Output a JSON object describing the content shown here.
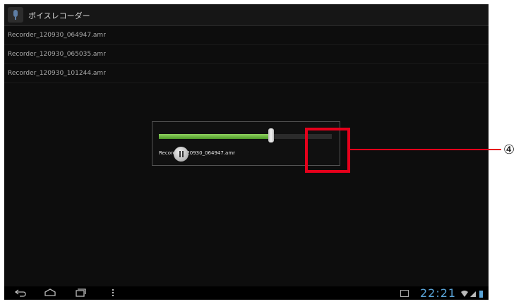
{
  "app": {
    "title": "ボイスレコーダー",
    "icon": "microphone-icon"
  },
  "recordings": [
    {
      "filename": "Recorder_120930_064947.amr"
    },
    {
      "filename": "Recorder_120930_065035.amr"
    },
    {
      "filename": "Recorder_120930_101244.amr"
    }
  ],
  "player": {
    "filename": "Recorder_120930_064947.amr",
    "progress": 0.65,
    "button_icon": "pause-icon",
    "accent": "#6cb43e"
  },
  "annotation": {
    "label": "④",
    "color": "#e5001b"
  },
  "navbar": {
    "icons": [
      "back-icon",
      "home-icon",
      "recent-apps-icon",
      "menu-icon"
    ],
    "clock": "22:21",
    "status_icons": [
      "notification-image-icon",
      "wifi-icon",
      "signal-icon",
      "battery-icon"
    ]
  }
}
